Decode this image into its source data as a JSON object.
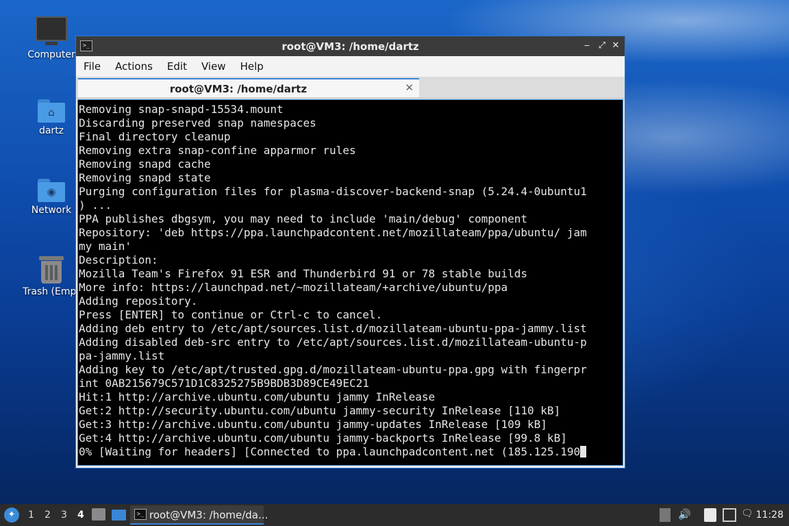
{
  "desktop": {
    "icons": [
      {
        "label": "Computer",
        "icon": "monitor-icon"
      },
      {
        "label": "dartz",
        "icon": "home-folder-icon"
      },
      {
        "label": "Network",
        "icon": "network-folder-icon"
      },
      {
        "label": "Trash (Empt",
        "icon": "trash-icon"
      }
    ]
  },
  "window": {
    "title": "root@VM3: /home/dartz",
    "controls": {
      "minimize": "‒",
      "maximize": "⤢",
      "close": "✕"
    },
    "menu": [
      "File",
      "Actions",
      "Edit",
      "View",
      "Help"
    ],
    "tab": {
      "title": "root@VM3: /home/dartz",
      "close": "✕"
    },
    "terminal_lines": [
      "Removing snap-snapd-15534.mount",
      "Discarding preserved snap namespaces",
      "Final directory cleanup",
      "Removing extra snap-confine apparmor rules",
      "Removing snapd cache",
      "Removing snapd state",
      "Purging configuration files for plasma-discover-backend-snap (5.24.4-0ubuntu1",
      ") ...",
      "PPA publishes dbgsym, you may need to include 'main/debug' component",
      "Repository: 'deb https://ppa.launchpadcontent.net/mozillateam/ppa/ubuntu/ jam",
      "my main'",
      "Description:",
      "Mozilla Team's Firefox 91 ESR and Thunderbird 91 or 78 stable builds",
      "More info: https://launchpad.net/~mozillateam/+archive/ubuntu/ppa",
      "Adding repository.",
      "Press [ENTER] to continue or Ctrl-c to cancel.",
      "Adding deb entry to /etc/apt/sources.list.d/mozillateam-ubuntu-ppa-jammy.list",
      "Adding disabled deb-src entry to /etc/apt/sources.list.d/mozillateam-ubuntu-p",
      "pa-jammy.list",
      "Adding key to /etc/apt/trusted.gpg.d/mozillateam-ubuntu-ppa.gpg with fingerpr",
      "int 0AB215679C571D1C8325275B9BDB3D89CE49EC21",
      "Hit:1 http://archive.ubuntu.com/ubuntu jammy InRelease",
      "Get:2 http://security.ubuntu.com/ubuntu jammy-security InRelease [110 kB]",
      "Get:3 http://archive.ubuntu.com/ubuntu jammy-updates InRelease [109 kB]",
      "Get:4 http://archive.ubuntu.com/ubuntu jammy-backports InRelease [99.8 kB]",
      "0% [Waiting for headers] [Connected to ppa.launchpadcontent.net (185.125.190"
    ]
  },
  "taskbar": {
    "workspaces": [
      "1",
      "2",
      "3",
      "4"
    ],
    "active_workspace": "4",
    "task_label": "root@VM3: /home/da...",
    "clock": "11:28",
    "tray_icons": [
      "updates-icon",
      "volume-icon",
      "clipboard-icon",
      "network-icon",
      "notification-icon"
    ]
  },
  "colors": {
    "accent": "#3a84d6",
    "terminal_bg": "#000000",
    "terminal_fg": "#e6e6e6"
  }
}
